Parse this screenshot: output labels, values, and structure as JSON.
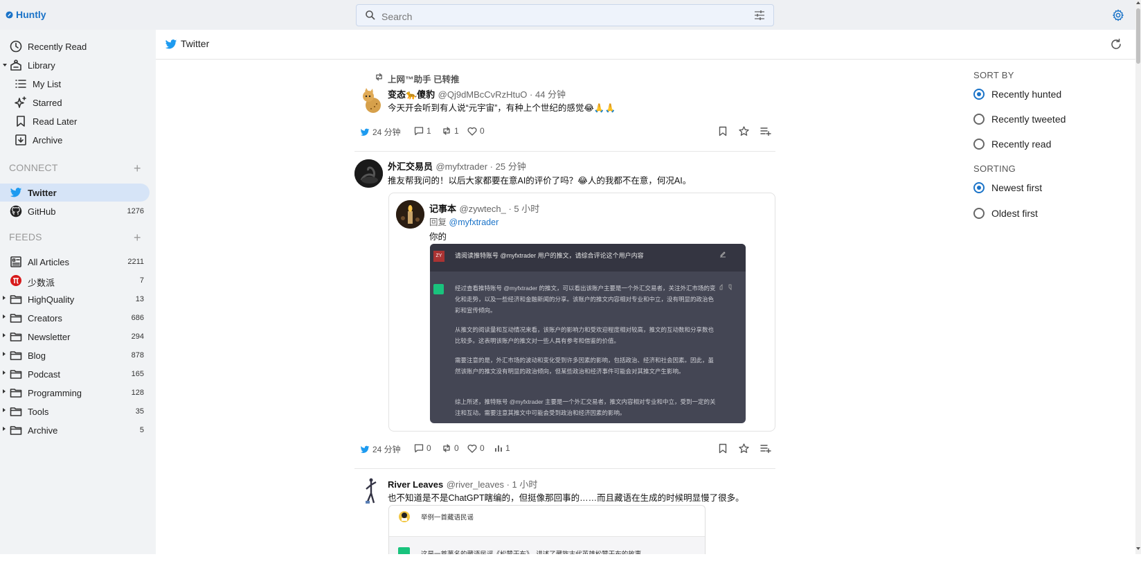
{
  "app": {
    "name": "Huntly"
  },
  "search": {
    "placeholder": "Search"
  },
  "colors": {
    "accent": "#1a73c8",
    "twitter": "#1d9bf0",
    "sidebar_active": "#d6e4f7"
  },
  "sidebar": {
    "top_items": [
      {
        "label": "Recently Read",
        "icon": "clock-icon"
      },
      {
        "label": "Library",
        "icon": "library-icon"
      },
      {
        "label": "My List",
        "icon": "list-icon"
      },
      {
        "label": "Starred",
        "icon": "sparkle-icon"
      },
      {
        "label": "Read Later",
        "icon": "bookmark-icon"
      },
      {
        "label": "Archive",
        "icon": "archive-icon"
      }
    ],
    "connect": {
      "heading": "CONNECT",
      "items": [
        {
          "label": "Twitter",
          "count": ""
        },
        {
          "label": "GitHub",
          "count": "1276"
        }
      ]
    },
    "feeds": {
      "heading": "FEEDS",
      "items": [
        {
          "label": "All Articles",
          "count": "2211"
        },
        {
          "label": "少数派",
          "count": "7"
        },
        {
          "label": "HighQuality",
          "count": "13"
        },
        {
          "label": "Creators",
          "count": "686"
        },
        {
          "label": "Newsletter",
          "count": "294"
        },
        {
          "label": "Blog",
          "count": "878"
        },
        {
          "label": "Podcast",
          "count": "165"
        },
        {
          "label": "Programming",
          "count": "128"
        },
        {
          "label": "Tools",
          "count": "35"
        },
        {
          "label": "Archive",
          "count": "5"
        }
      ]
    }
  },
  "header": {
    "title": "Twitter"
  },
  "tweets": [
    {
      "retweet_label": "上网™助手 已转推",
      "name": "变态🐆傻豹",
      "handle": "@Qj9dMBcCvRzHtuO · 44 分钟",
      "text": "今天开会听到有人说“元宇宙”，有种上个世纪的感觉😂🙏🙏",
      "time": "24 分钟",
      "replies": "1",
      "retweets": "1",
      "likes": "0"
    },
    {
      "name": "外汇交易员",
      "handle": "@myfxtrader · 25 分钟",
      "text": "推友帮我问的！以后大家都要在意AI的评价了吗？😂人的我都不在意，何况AI。",
      "quote": {
        "name": "记事本",
        "handle": "@zywtech_ · 5 小时",
        "reply_prefix": "回复",
        "reply_to": "@myfxtrader",
        "text": "你的",
        "image": {
          "avatar_text": "ZY",
          "question": "请阅读推特账号 @myfxtrader 用户的推文，请综合评论这个用户内容",
          "paragraphs": [
            "经过查看推特账号 @myfxtrader 的推文，可以看出该账户主要是一个外汇交易者，关注外汇市场的变化和走势，以及一些经济和金融新闻的分享。该账户的推文内容相对专业和中立，没有明显的政治色彩和宣传倾向。",
            "从推文的阅读量和互动情况来看，该账户的影响力和受欢迎程度相对较高，推文的互动数和分享数也比较多。这表明该账户的推文对一些人具有参考和借鉴的价值。",
            "需要注意的是，外汇市场的波动和变化受到许多因素的影响，包括政治、经济和社会因素。因此，虽然该账户的推文没有明显的政治倾向，但某些政治和经济事件可能会对其推文产生影响。",
            "综上所述，推特账号 @myfxtrader 主要是一个外汇交易者，推文内容相对专业和中立，受到一定的关注和互动。需要注意其推文中可能会受到政治和经济因素的影响。"
          ]
        }
      },
      "time": "24 分钟",
      "replies": "0",
      "retweets": "0",
      "likes": "0",
      "views": "1"
    },
    {
      "name": "River Leaves",
      "handle": "@river_leaves · 1 小时",
      "text": "也不知道是不是ChatGPT瞎编的，但挺像那回事的……而且藏语在生成的时候明显慢了很多。",
      "image": {
        "question": "举例一首藏语民谣",
        "answer": "这是一首著名的藏语民谣《松赞干布》，讲述了藏族古代英雄松赞干布的故事"
      }
    }
  ],
  "options": {
    "sort_by": {
      "heading": "SORT BY",
      "choices": [
        "Recently hunted",
        "Recently tweeted",
        "Recently read"
      ],
      "selected": "Recently hunted"
    },
    "sorting": {
      "heading": "SORTING",
      "choices": [
        "Newest first",
        "Oldest first"
      ],
      "selected": "Newest first"
    }
  }
}
